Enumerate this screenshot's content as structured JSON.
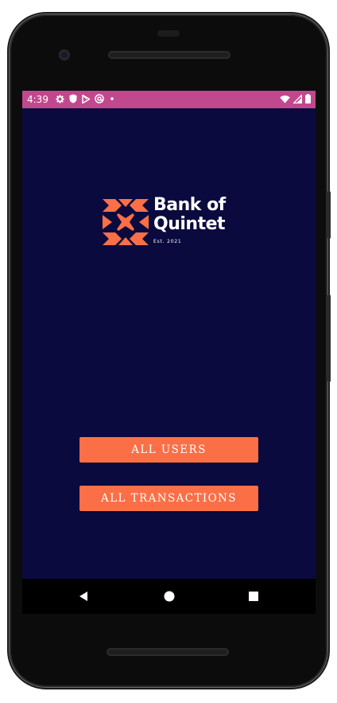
{
  "status_bar": {
    "time": "4:39",
    "left_icons": [
      "gear-icon",
      "shield-icon",
      "play-store-icon",
      "at-sign-icon",
      "dot-icon"
    ],
    "right_icons": [
      "wifi-icon",
      "signal-icon",
      "battery-icon"
    ],
    "background": "#c2488e"
  },
  "logo": {
    "line1": "Bank of",
    "line2": "Quintet",
    "tagline": "Est. 2021",
    "mark_color": "#fb6f46"
  },
  "buttons": {
    "all_users": "ALL USERS",
    "all_transactions": "ALL TRANSACTIONS"
  },
  "nav_bar": {
    "items": [
      "back-icon",
      "home-icon",
      "recents-icon"
    ]
  },
  "colors": {
    "screen_background": "#0b0a3f",
    "accent": "#fb6f46",
    "status_bar": "#c2488e"
  }
}
